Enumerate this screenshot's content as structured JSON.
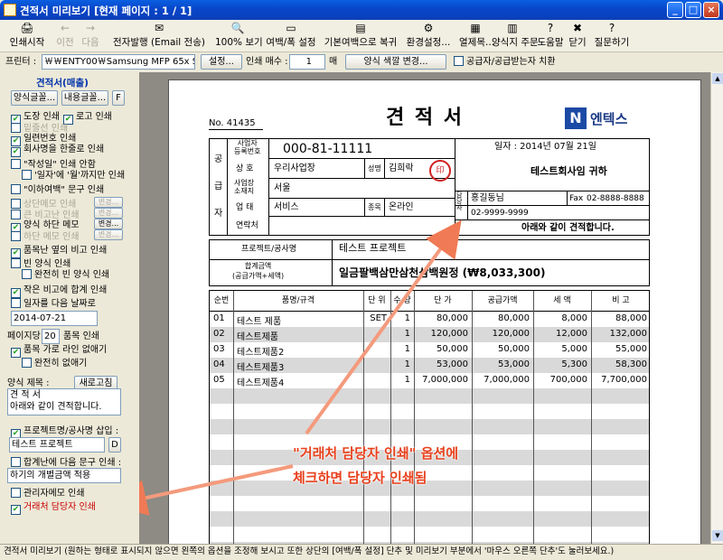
{
  "window": {
    "title": "견적서 미리보기 [현재 페이지 : 1 / 1]"
  },
  "toolbar": [
    {
      "label": "인쇄시작",
      "icon": "🖨",
      "dis": false
    },
    {
      "label": "이전",
      "icon": "←",
      "dis": true
    },
    {
      "label": "다음",
      "icon": "→",
      "dis": true
    },
    {
      "label": "전자발행 (Email 전송)",
      "icon": "✉",
      "dis": false
    },
    {
      "label": "100% 보기",
      "icon": "🔍",
      "dis": false
    },
    {
      "label": "여백/폭 설정",
      "icon": "▭",
      "dis": false
    },
    {
      "label": "기본여백으로 복귀",
      "icon": "▤",
      "dis": false
    },
    {
      "label": "환경설정...",
      "icon": "⚙",
      "dis": false
    },
    {
      "label": "열제목...",
      "icon": "▦",
      "dis": false
    },
    {
      "label": "양식지 주문",
      "icon": "▥",
      "dis": false
    },
    {
      "label": "도움말",
      "icon": "?",
      "dis": false
    },
    {
      "label": "닫기",
      "icon": "✖",
      "dis": false
    },
    {
      "label": "질문하기",
      "icon": "?",
      "dis": false
    }
  ],
  "printer": {
    "label": "프린터 :",
    "value": "￦￦ENTY00￦Samsung MFP 65x Serie",
    "settings": "설정...",
    "copies_label": "인쇄 매수 :",
    "copies": "1",
    "copies_unit": "매",
    "color_btn": "양식 색깔 변경...",
    "swap_label": "공급자/공급받는자 치환"
  },
  "left": {
    "title": "견적서(매출)",
    "btn1": "양식글꼴...",
    "btn2": "내용글꼴...",
    "btn3": "F",
    "items": [
      {
        "label": "도장 인쇄",
        "checked": true,
        "dim": false
      },
      {
        "label": "로고 인쇄",
        "checked": true,
        "dim": false
      },
      {
        "label": "밑줄선 인쇄",
        "checked": false,
        "dim": true
      },
      {
        "label": "일련번호 인쇄",
        "checked": true,
        "dim": false
      },
      {
        "label": "회사명을 한줄로 인쇄",
        "checked": true,
        "dim": false
      },
      {
        "label": "\"작성일\" 인쇄 안함",
        "checked": false,
        "dim": false
      },
      {
        "label": "'일자'에 '월'까지만 인쇄",
        "checked": false,
        "dim": false
      },
      {
        "label": "\"이하여백\" 문구 인쇄",
        "checked": false,
        "dim": false
      },
      {
        "label": "상단메모 인쇄",
        "checked": false,
        "dim": true
      },
      {
        "label": "큰 비고난 인쇄",
        "checked": false,
        "dim": true
      },
      {
        "label": "양식 하단 메모",
        "checked": true,
        "dim": false
      },
      {
        "label": "하단 메모 인쇄",
        "checked": false,
        "dim": true
      },
      {
        "label": "품목난 옆의 비고 인쇄",
        "checked": true,
        "dim": false
      },
      {
        "label": "빈 양식 인쇄",
        "checked": false,
        "dim": false
      },
      {
        "label": "완전히 빈 양식 인쇄",
        "checked": false,
        "dim": false
      },
      {
        "label": "작은 비고에 합계 인쇄",
        "checked": true,
        "dim": false
      },
      {
        "label": "일자를 다음 날짜로",
        "checked": false,
        "dim": false
      }
    ],
    "change": "변경...",
    "date": "2014-07-21",
    "per_page_label": "페이지당",
    "per_page": "20",
    "per_page_unit": "품목 인쇄",
    "no_row_lines": "품목 가로 라인 없애기",
    "no_row_lines_full": "완전히 없애기",
    "form_title_label": "양식 제목 :",
    "refresh": "새로고침",
    "form_title": "견 적 서",
    "form_sub": "아래와 같이 견적합니다.",
    "project_insert": "프로젝트명/공사명 삽입 :",
    "project_value": "테스트 프로젝트",
    "project_btn": "D",
    "total_next": "합계난에 다음 문구 인쇄 :",
    "total_text": "하기의 개별금액 적용",
    "admin_memo": "관리자메모 인쇄",
    "contact_print": "거래처 담당자 인쇄"
  },
  "doc": {
    "no": "No. 41435",
    "title": "견 적 서",
    "logo": "엔텍스",
    "reg_label": "사업자\n등록번호",
    "reg_no": "000-81-11111",
    "side_labels": [
      "공",
      "급",
      "자"
    ],
    "company_label": "상 호",
    "company": "우리사업장",
    "name_label": "성명",
    "ceo": "김희락",
    "addr_label": "사업장\n소재지",
    "addr": "서울",
    "biz_type_label": "업 태",
    "biz_type": "서비스",
    "biz_item_label": "종목",
    "biz_item": "온라인",
    "contact_label": "연락처",
    "date_text": "일자 : 2014년 07월 21일",
    "client": "테스트회사임   귀하",
    "person_label": "담당자",
    "person": "홍길동님",
    "fax_label": "Fax",
    "fax": "02-8888-8888",
    "phone": "02-9999-9999",
    "greeting": "아래와 같이 견적합니다.",
    "project_label": "프로젝트/공사명",
    "project": "테스트 프로젝트",
    "total_label": "합계금액\n(공급가액+세액)",
    "total_text": "일금팔백삼만삼천삼백원정 (₩8,033,300)",
    "headers": [
      "순번",
      "품명/규격",
      "단 위",
      "수 량",
      "단 가",
      "공급가액",
      "세 액",
      "비 고"
    ],
    "rows": [
      [
        "01",
        "테스트 제품",
        "SET",
        "1",
        "80,000",
        "80,000",
        "8,000",
        "88,000"
      ],
      [
        "02",
        "테스트제품",
        "",
        "1",
        "120,000",
        "120,000",
        "12,000",
        "132,000"
      ],
      [
        "03",
        "테스트제품2",
        "",
        "1",
        "50,000",
        "50,000",
        "5,000",
        "55,000"
      ],
      [
        "04",
        "테스트제품3",
        "",
        "1",
        "53,000",
        "53,000",
        "5,300",
        "58,300"
      ],
      [
        "05",
        "테스트제품4",
        "",
        "1",
        "7,000,000",
        "7,000,000",
        "700,000",
        "7,700,000"
      ]
    ]
  },
  "annotation": {
    "line1": "\"거래처 담당자 인쇄\" 옵션에",
    "line2": "체크하면 담당자 인쇄됨",
    "color": "#e8401c"
  },
  "status": "견적서 미리보기 (원하는 형태로 표시되지 않으면 왼쪽의 옵션을 조정해 보시고 또한 상단의 [여백/폭 설정] 단추 및 미리보기 부분에서 '마우스 오른쪽 단추'도 눌러보세요.)"
}
